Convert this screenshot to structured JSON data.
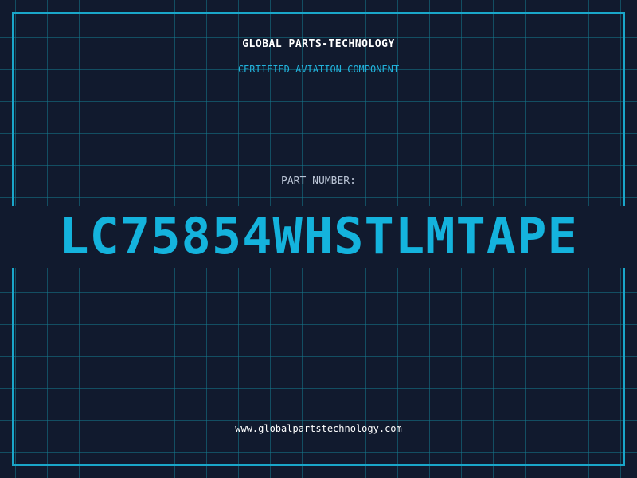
{
  "header": {
    "brand": "GLOBAL PARTS-TECHNOLOGY",
    "tagline": "CERTIFIED AVIATION COMPONENT"
  },
  "part": {
    "label": "PART NUMBER:",
    "number": "LC75854WHSTLMTAPE"
  },
  "footer": {
    "website": "www.globalpartstechnology.com"
  },
  "colors": {
    "background": "#111a2e",
    "accent": "#14b3dd",
    "grid": "#14788c",
    "text": "#ffffff"
  }
}
